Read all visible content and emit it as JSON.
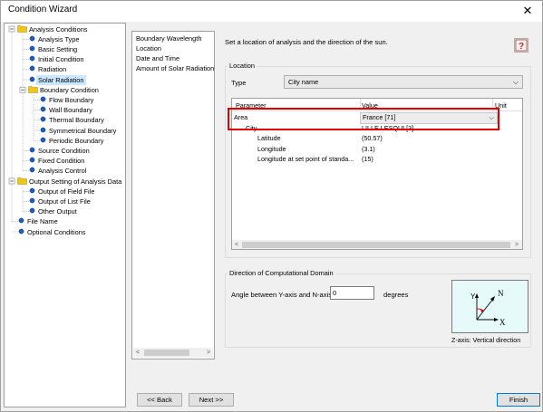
{
  "window": {
    "title": "Condition Wizard"
  },
  "tree": {
    "items": [
      {
        "label": "Analysis Conditions",
        "level": 0,
        "icon": "folder-icon",
        "selected": false
      },
      {
        "label": "Analysis Type",
        "level": 1,
        "icon": "dot-icon",
        "selected": false
      },
      {
        "label": "Basic Setting",
        "level": 1,
        "icon": "dot-icon",
        "selected": false
      },
      {
        "label": "Initial Condition",
        "level": 1,
        "icon": "dot-icon",
        "selected": false
      },
      {
        "label": "Radiation",
        "level": 1,
        "icon": "dot-icon",
        "selected": false
      },
      {
        "label": "Solar Radiation",
        "level": 1,
        "icon": "dot-icon",
        "selected": true
      },
      {
        "label": "Boundary Condition",
        "level": 1,
        "icon": "folder-icon",
        "selected": false
      },
      {
        "label": "Flow Boundary",
        "level": 2,
        "icon": "dot-icon",
        "selected": false
      },
      {
        "label": "Wall Boundary",
        "level": 2,
        "icon": "dot-icon",
        "selected": false
      },
      {
        "label": "Thermal Boundary",
        "level": 2,
        "icon": "dot-icon",
        "selected": false
      },
      {
        "label": "Symmetrical Boundary",
        "level": 2,
        "icon": "dot-icon",
        "selected": false
      },
      {
        "label": "Periodic Boundary",
        "level": 2,
        "icon": "dot-icon",
        "selected": false
      },
      {
        "label": "Source Condition",
        "level": 1,
        "icon": "dot-icon",
        "selected": false
      },
      {
        "label": "Fixed Condition",
        "level": 1,
        "icon": "dot-icon",
        "selected": false
      },
      {
        "label": "Analysis Control",
        "level": 1,
        "icon": "dot-icon",
        "selected": false
      },
      {
        "label": "Output Setting of Analysis Data",
        "level": 0,
        "icon": "folder-icon",
        "selected": false
      },
      {
        "label": "Output of Field File",
        "level": 1,
        "icon": "dot-icon",
        "selected": false
      },
      {
        "label": "Output of List File",
        "level": 1,
        "icon": "dot-icon",
        "selected": false
      },
      {
        "label": "Other Output",
        "level": 1,
        "icon": "dot-icon",
        "selected": false
      },
      {
        "label": "File Name",
        "level": 0,
        "icon": "dot-icon",
        "selected": false
      },
      {
        "label": "Optional Conditions",
        "level": 0,
        "icon": "dot-icon",
        "selected": false
      }
    ]
  },
  "pages": [
    "Boundary Wavelength",
    "Location",
    "Date and Time",
    "Amount of Solar Radiation"
  ],
  "description": "Set a location of analysis and the direction of the sun.",
  "location": {
    "group_label": "Location",
    "type_label": "Type",
    "type_value": "City name",
    "columns": [
      "Parameter",
      "Value",
      "Unit"
    ],
    "rows": [
      {
        "param": "Area",
        "value": "France [71]",
        "unit": "",
        "indent": 0,
        "combo": true
      },
      {
        "param": "City",
        "value": "LILLE LESQUI [3]",
        "unit": "",
        "indent": 1,
        "combo": false
      },
      {
        "param": "Latitude",
        "value": "(50.57)",
        "unit": "",
        "indent": 2,
        "combo": false
      },
      {
        "param": "Longitude",
        "value": "(3.1)",
        "unit": "",
        "indent": 2,
        "combo": false
      },
      {
        "param": "Longitude at set point of standa...",
        "value": "(15)",
        "unit": "",
        "indent": 2,
        "combo": false
      }
    ]
  },
  "direction": {
    "group_label": "Direction of Computational Domain",
    "angle_label": "Angle between Y-axis and N-axis",
    "angle_value": "0",
    "unit": "degrees",
    "diagram": {
      "y": "Y",
      "n": "N",
      "x": "X"
    },
    "caption": "Z-axis: Vertical direction"
  },
  "buttons": {
    "back": "<< Back",
    "next": "Next >>",
    "finish": "Finish"
  },
  "colors": {
    "accent": "#0078d7",
    "highlight": "#e00000",
    "selected": "#cce8ff",
    "folder": "#f0c419",
    "dot": "#1f5fbf"
  }
}
